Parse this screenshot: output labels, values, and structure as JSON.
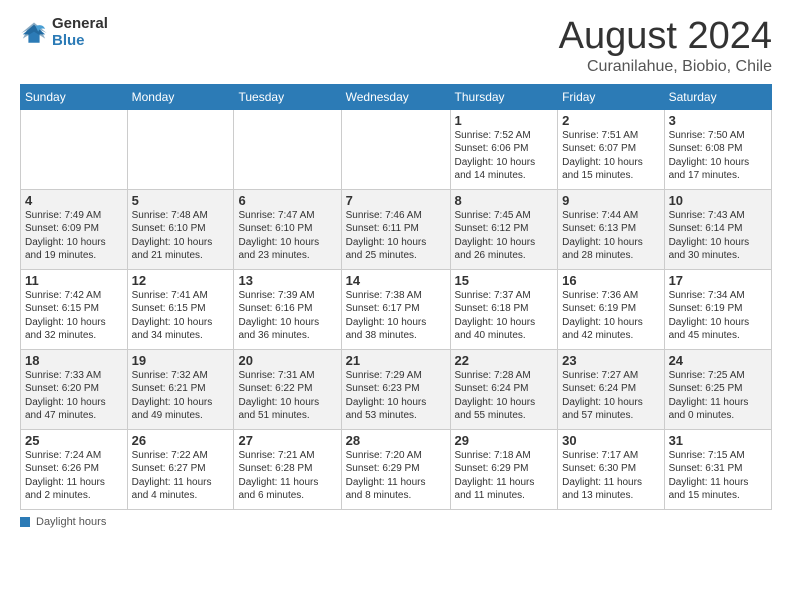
{
  "header": {
    "logo_line1": "General",
    "logo_line2": "Blue",
    "title": "August 2024",
    "location": "Curanilahue, Biobio, Chile"
  },
  "weekdays": [
    "Sunday",
    "Monday",
    "Tuesday",
    "Wednesday",
    "Thursday",
    "Friday",
    "Saturday"
  ],
  "weeks": [
    [
      {
        "day": "",
        "info": ""
      },
      {
        "day": "",
        "info": ""
      },
      {
        "day": "",
        "info": ""
      },
      {
        "day": "",
        "info": ""
      },
      {
        "day": "1",
        "info": "Sunrise: 7:52 AM\nSunset: 6:06 PM\nDaylight: 10 hours\nand 14 minutes."
      },
      {
        "day": "2",
        "info": "Sunrise: 7:51 AM\nSunset: 6:07 PM\nDaylight: 10 hours\nand 15 minutes."
      },
      {
        "day": "3",
        "info": "Sunrise: 7:50 AM\nSunset: 6:08 PM\nDaylight: 10 hours\nand 17 minutes."
      }
    ],
    [
      {
        "day": "4",
        "info": "Sunrise: 7:49 AM\nSunset: 6:09 PM\nDaylight: 10 hours\nand 19 minutes."
      },
      {
        "day": "5",
        "info": "Sunrise: 7:48 AM\nSunset: 6:10 PM\nDaylight: 10 hours\nand 21 minutes."
      },
      {
        "day": "6",
        "info": "Sunrise: 7:47 AM\nSunset: 6:10 PM\nDaylight: 10 hours\nand 23 minutes."
      },
      {
        "day": "7",
        "info": "Sunrise: 7:46 AM\nSunset: 6:11 PM\nDaylight: 10 hours\nand 25 minutes."
      },
      {
        "day": "8",
        "info": "Sunrise: 7:45 AM\nSunset: 6:12 PM\nDaylight: 10 hours\nand 26 minutes."
      },
      {
        "day": "9",
        "info": "Sunrise: 7:44 AM\nSunset: 6:13 PM\nDaylight: 10 hours\nand 28 minutes."
      },
      {
        "day": "10",
        "info": "Sunrise: 7:43 AM\nSunset: 6:14 PM\nDaylight: 10 hours\nand 30 minutes."
      }
    ],
    [
      {
        "day": "11",
        "info": "Sunrise: 7:42 AM\nSunset: 6:15 PM\nDaylight: 10 hours\nand 32 minutes."
      },
      {
        "day": "12",
        "info": "Sunrise: 7:41 AM\nSunset: 6:15 PM\nDaylight: 10 hours\nand 34 minutes."
      },
      {
        "day": "13",
        "info": "Sunrise: 7:39 AM\nSunset: 6:16 PM\nDaylight: 10 hours\nand 36 minutes."
      },
      {
        "day": "14",
        "info": "Sunrise: 7:38 AM\nSunset: 6:17 PM\nDaylight: 10 hours\nand 38 minutes."
      },
      {
        "day": "15",
        "info": "Sunrise: 7:37 AM\nSunset: 6:18 PM\nDaylight: 10 hours\nand 40 minutes."
      },
      {
        "day": "16",
        "info": "Sunrise: 7:36 AM\nSunset: 6:19 PM\nDaylight: 10 hours\nand 42 minutes."
      },
      {
        "day": "17",
        "info": "Sunrise: 7:34 AM\nSunset: 6:19 PM\nDaylight: 10 hours\nand 45 minutes."
      }
    ],
    [
      {
        "day": "18",
        "info": "Sunrise: 7:33 AM\nSunset: 6:20 PM\nDaylight: 10 hours\nand 47 minutes."
      },
      {
        "day": "19",
        "info": "Sunrise: 7:32 AM\nSunset: 6:21 PM\nDaylight: 10 hours\nand 49 minutes."
      },
      {
        "day": "20",
        "info": "Sunrise: 7:31 AM\nSunset: 6:22 PM\nDaylight: 10 hours\nand 51 minutes."
      },
      {
        "day": "21",
        "info": "Sunrise: 7:29 AM\nSunset: 6:23 PM\nDaylight: 10 hours\nand 53 minutes."
      },
      {
        "day": "22",
        "info": "Sunrise: 7:28 AM\nSunset: 6:24 PM\nDaylight: 10 hours\nand 55 minutes."
      },
      {
        "day": "23",
        "info": "Sunrise: 7:27 AM\nSunset: 6:24 PM\nDaylight: 10 hours\nand 57 minutes."
      },
      {
        "day": "24",
        "info": "Sunrise: 7:25 AM\nSunset: 6:25 PM\nDaylight: 11 hours\nand 0 minutes."
      }
    ],
    [
      {
        "day": "25",
        "info": "Sunrise: 7:24 AM\nSunset: 6:26 PM\nDaylight: 11 hours\nand 2 minutes."
      },
      {
        "day": "26",
        "info": "Sunrise: 7:22 AM\nSunset: 6:27 PM\nDaylight: 11 hours\nand 4 minutes."
      },
      {
        "day": "27",
        "info": "Sunrise: 7:21 AM\nSunset: 6:28 PM\nDaylight: 11 hours\nand 6 minutes."
      },
      {
        "day": "28",
        "info": "Sunrise: 7:20 AM\nSunset: 6:29 PM\nDaylight: 11 hours\nand 8 minutes."
      },
      {
        "day": "29",
        "info": "Sunrise: 7:18 AM\nSunset: 6:29 PM\nDaylight: 11 hours\nand 11 minutes."
      },
      {
        "day": "30",
        "info": "Sunrise: 7:17 AM\nSunset: 6:30 PM\nDaylight: 11 hours\nand 13 minutes."
      },
      {
        "day": "31",
        "info": "Sunrise: 7:15 AM\nSunset: 6:31 PM\nDaylight: 11 hours\nand 15 minutes."
      }
    ]
  ],
  "footer": {
    "label": "Daylight hours"
  }
}
